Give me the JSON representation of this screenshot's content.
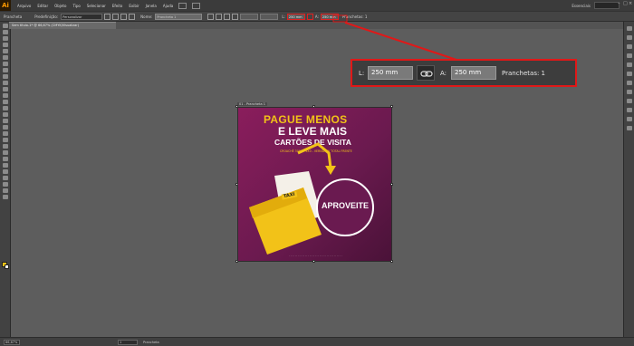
{
  "app": {
    "logo": "Ai",
    "workspace": "Essenciais"
  },
  "menu": [
    "Arquivo",
    "Editar",
    "Objeto",
    "Tipo",
    "Selecionar",
    "Efeito",
    "Exibir",
    "Janela",
    "Ajuda"
  ],
  "control_bar": {
    "mode_label": "Prancheta",
    "preset_label": "Predefinição:",
    "preset_value": "Personalizar",
    "name_label": "Nome:",
    "name_value": "Prancheta 1",
    "w_value": "250 mm",
    "h_value": "250 mm",
    "w_label": "L:",
    "h_label": "A:",
    "artboards_label": "Pranchetas: 1"
  },
  "document_tab": {
    "title": "Sem título-1* @ 66,67% (CMYK/Visualizar)"
  },
  "artboard": {
    "label": "01 - Prancheta 1",
    "headline1": "PAGUE MENOS",
    "headline2": "E LEVE MAIS",
    "headline3": "CARTÕES DE VISITA",
    "subline": "CROACHÊ 300G - 4X0 - VERNIZ UV TOTAL FRENTE",
    "taxi": "TAXI",
    "circle_text": "APROVEITE",
    "colors": {
      "background": "#8a1d5c",
      "accent": "#f2c218",
      "white": "#ffffff"
    }
  },
  "callout": {
    "w_label": "L:",
    "w_value": "250 mm",
    "h_label": "A:",
    "h_value": "250 mm",
    "artboards": "Pranchetas: 1",
    "link_icon": "chain-link-icon",
    "highlight_color": "#e01818"
  },
  "status_bar": {
    "zoom": "66,67%",
    "artboard": "1",
    "label": "Prancheta"
  }
}
